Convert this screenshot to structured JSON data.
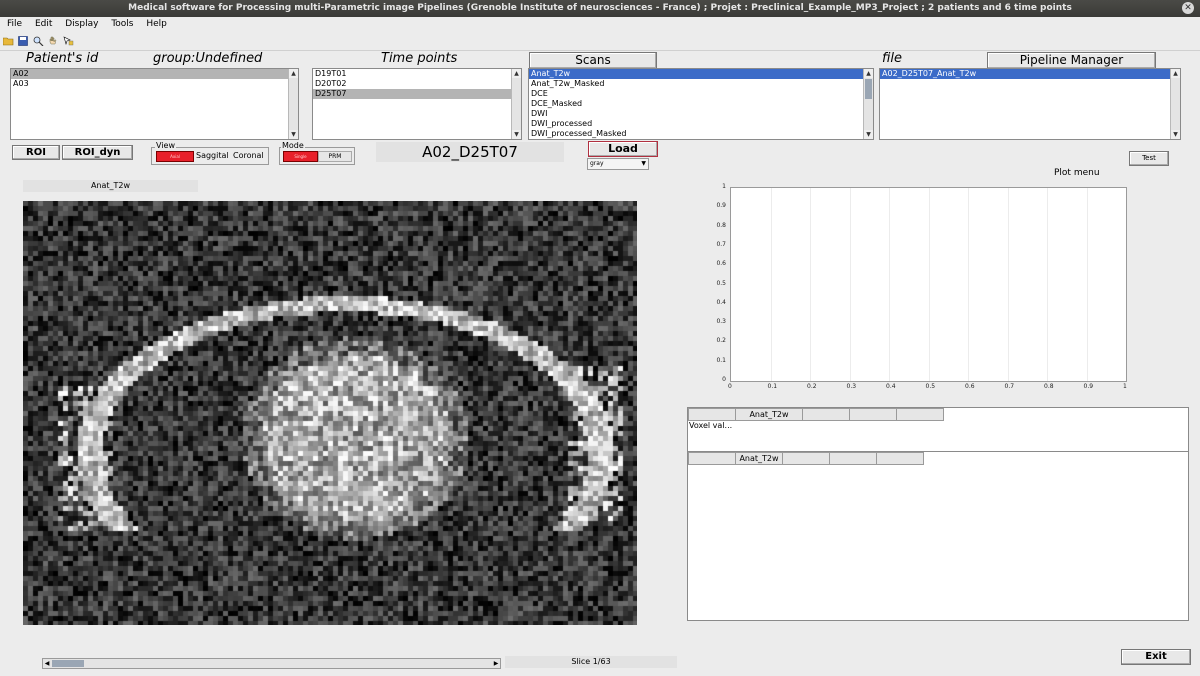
{
  "window": {
    "title": "Medical software for Processing multi-Parametric image Pipelines (Grenoble Institute of neurosciences - France) ; Projet : Preclinical_Example_MP3_Project ; 2 patients and 6 time points",
    "close": "✕"
  },
  "menu": [
    "File",
    "Edit",
    "Display",
    "Tools",
    "Help"
  ],
  "toolbar_icons": [
    "open-folder-icon",
    "save-icon",
    "zoom-icon",
    "pan-hand-icon",
    "data-cursor-icon"
  ],
  "patients": {
    "header": "Patient's id",
    "group": "group:Undefined",
    "items": [
      "A02",
      "A03"
    ],
    "selected": 0
  },
  "timepoints": {
    "header": "Time points",
    "items": [
      "D19T01",
      "D20T02",
      "D25T07"
    ],
    "selected": 2
  },
  "scans": {
    "header": "Scans",
    "items": [
      "Anat_T2w",
      "Anat_T2w_Masked",
      "DCE",
      "DCE_Masked",
      "DWI",
      "DWI_processed",
      "DWI_processed_Masked"
    ],
    "selected": 0
  },
  "files": {
    "header": "file",
    "pipeline_button": "Pipeline Manager",
    "items": [
      "A02_D25T07_Anat_T2w"
    ],
    "selected": 0
  },
  "controls": {
    "roi": "ROI",
    "roi_dyn": "ROI_dyn",
    "view_label": "View",
    "view_options": [
      "Axial",
      "Saggital",
      "Coronal"
    ],
    "mode_label": "Mode",
    "mode_options": [
      "Single",
      "PRM"
    ],
    "current_scan_title": "A02_D25T07",
    "load": "Load",
    "colormap": "gray",
    "test": "Test"
  },
  "image": {
    "label": "Anat_T2w",
    "slice_text": "Slice 1/63"
  },
  "plot": {
    "title": "Plot menu",
    "y_ticks": [
      "0",
      "0.1",
      "0.2",
      "0.3",
      "0.4",
      "0.5",
      "0.6",
      "0.7",
      "0.8",
      "0.9",
      "1"
    ],
    "x_ticks": [
      "0",
      "0.1",
      "0.2",
      "0.3",
      "0.4",
      "0.5",
      "0.6",
      "0.7",
      "0.8",
      "0.9",
      "1"
    ]
  },
  "table1": {
    "col_header": "Anat_T2w",
    "row_label": "Voxel val..."
  },
  "table2": {
    "col_header": "Anat_T2w"
  },
  "exit": "Exit",
  "colors": {
    "selection_blue": "#3b6bc8",
    "selection_grey": "#b4b4b4",
    "switch_red": "#e8202a"
  }
}
